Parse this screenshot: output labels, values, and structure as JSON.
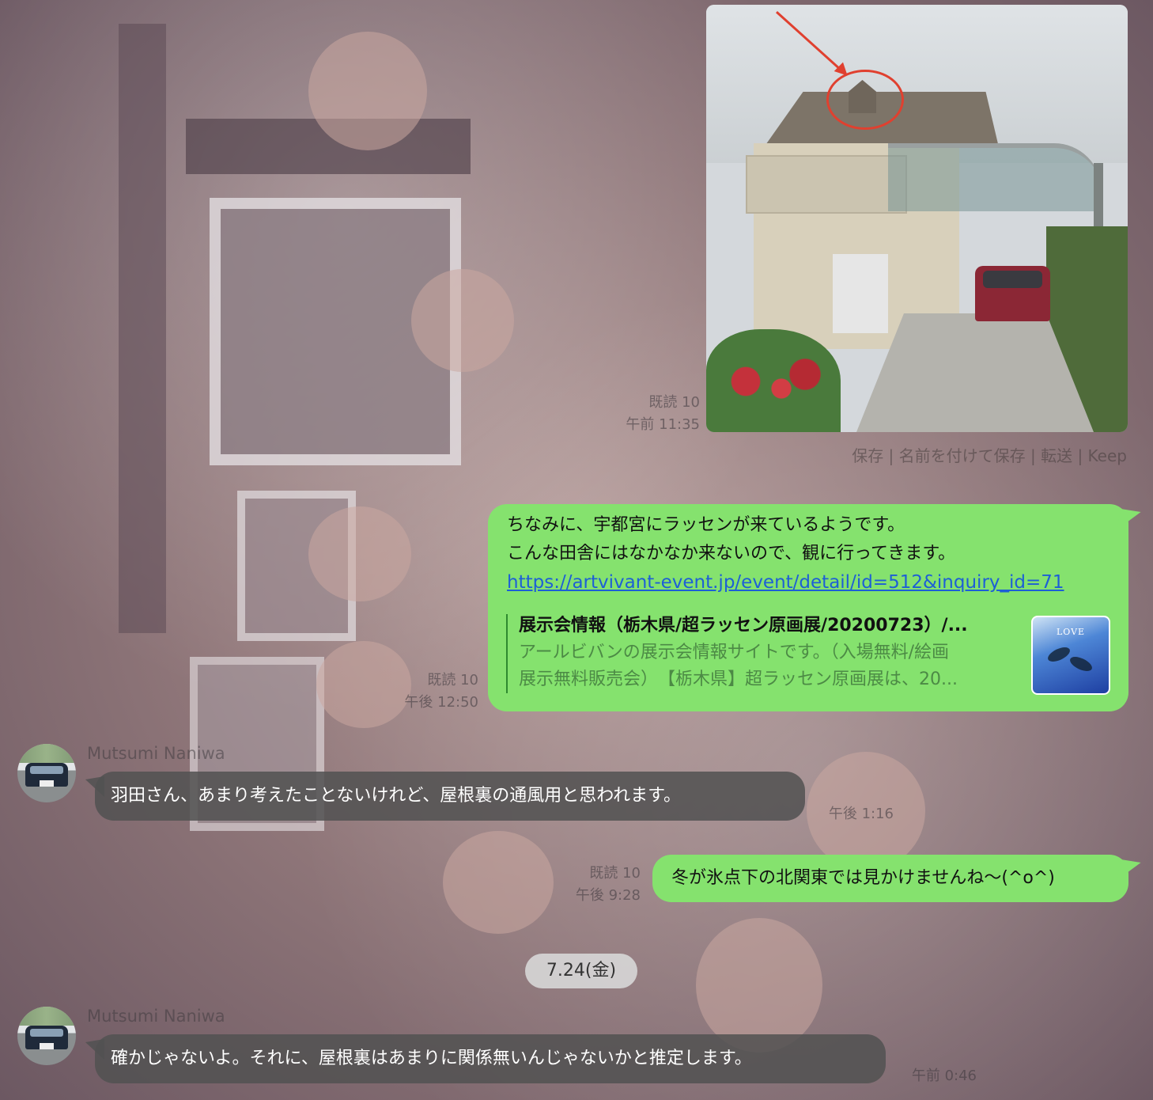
{
  "chat": {
    "image_message": {
      "read": "既読 10",
      "time": "午前 11:35",
      "actions": "保存 | 名前を付けて保存 | 転送 | Keep"
    },
    "message1": {
      "lines": [
        "ちなみに、宇都宮にラッセンが来ているようです。",
        "こんな田舎にはなかなか来ないので、観に行ってきます。"
      ],
      "link": "https://artvivant-event.jp/event/detail/id=512&inquiry_id=71",
      "preview": {
        "title": "展示会情報（栃木県/超ラッセン原画展/20200723）/...",
        "description": [
          "アールビバンの展示会情報サイトです。（入場無料/絵画",
          "展示無料販売会）　【栃木県】超ラッセン原画展は、20..."
        ],
        "thumbnail_text": "LOVE"
      },
      "read": "既読 10",
      "time": "午後 12:50"
    },
    "message2": {
      "sender": "Mutsumi Naniwa",
      "text": "羽田さん、あまり考えたことないけれど、屋根裏の通風用と思われます。",
      "time": "午後 1:16"
    },
    "message3": {
      "text": "冬が氷点下の北関東では見かけませんね〜(^o^)",
      "read": "既読 10",
      "time": "午後 9:28"
    },
    "date_separator": "7.24(金)",
    "message4": {
      "sender": "Mutsumi Naniwa",
      "text": "確かじゃないよ。それに、屋根裏はあまりに関係無いんじゃないかと推定します。",
      "time": "午前 0:46"
    }
  },
  "colors": {
    "outgoing_bubble": "#85e26e",
    "incoming_bubble": "#525252",
    "link": "#1d5fd6",
    "annotation_red": "#e0402f"
  }
}
